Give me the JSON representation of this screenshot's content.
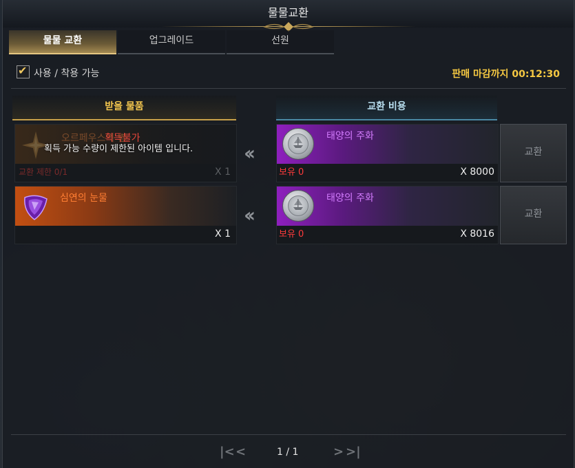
{
  "window": {
    "title": "물물교환"
  },
  "tabs": [
    {
      "label": "물물 교환",
      "active": true
    },
    {
      "label": "업그레이드",
      "active": false
    },
    {
      "label": "선원",
      "active": false
    }
  ],
  "filter": {
    "label": "사용 / 착용 가능",
    "checked": true
  },
  "deadline": "판매 마감까지 00:12:30",
  "headers": {
    "receive": "받을 물품",
    "cost": "교환 비용"
  },
  "rows": [
    {
      "receive": {
        "name": "오르페우스의 별",
        "qty": "X 1",
        "limit": "교환 제한 0/1",
        "unavailable_label": "획득불가",
        "tooltip": "획득 가능 수량이 제한된 아이템 입니다.",
        "icon": "star-icon"
      },
      "cost": {
        "name": "태양의 주화",
        "owned": "보유 0",
        "qty": "X 8000",
        "icon": "coin-icon"
      },
      "button": "교환"
    },
    {
      "receive": {
        "name": "심연의 눈물",
        "qty": "X 1",
        "icon": "gem-icon"
      },
      "cost": {
        "name": "태양의 주화",
        "owned": "보유 0",
        "qty": "X 8016",
        "icon": "coin-icon"
      },
      "button": "교환"
    }
  ],
  "pagination": {
    "text": "1 / 1"
  },
  "colors": {
    "accent_gold": "#f3c64e",
    "rare_purple": "#d47cff",
    "epic_orange": "#ff7e33",
    "warning_red": "#ff3b3b"
  }
}
